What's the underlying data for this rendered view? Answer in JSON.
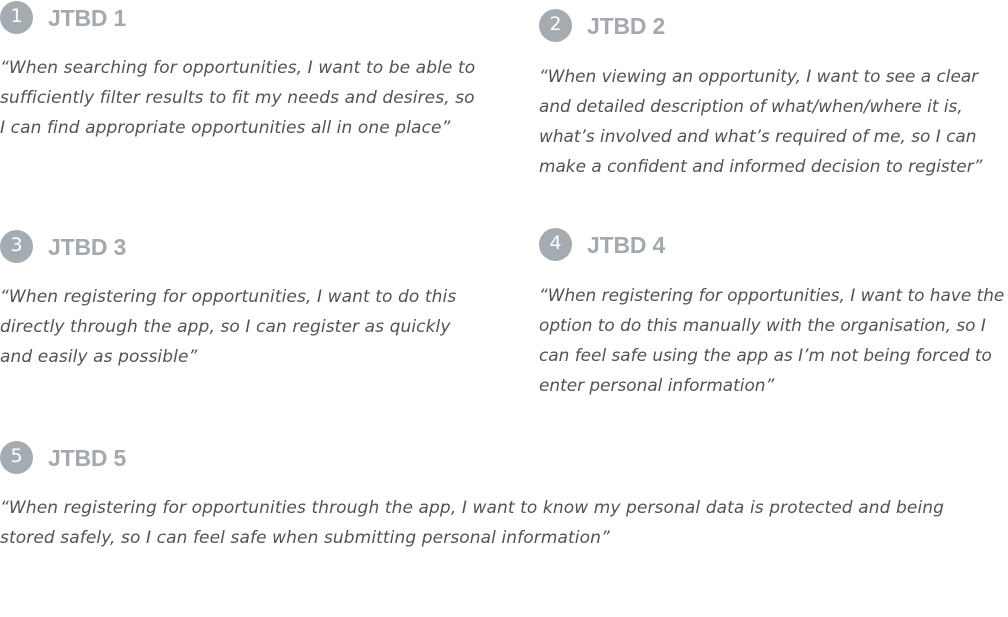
{
  "items": [
    {
      "number": "1",
      "title": "JTBD 1",
      "quote": "“When searching for opportunities, I want to be able to sufficiently filter results to fit my needs and desires, so I can find appropriate opportunities all in one place”"
    },
    {
      "number": "2",
      "title": "JTBD 2",
      "quote": "“When viewing an opportunity, I want to see a clear and detailed description of what/when/where it is, what’s involved and what’s required of me, so I can make a confident and informed decision to register”"
    },
    {
      "number": "3",
      "title": "JTBD 3",
      "quote": "“When registering for opportunities, I want to do this directly through the app, so I can register as quickly and easily as possible”"
    },
    {
      "number": "4",
      "title": "JTBD 4",
      "quote": "“When registering for opportunities, I want to have the option to do this manually with the organisation, so I can feel safe using the app as I’m not being forced to enter personal information”"
    },
    {
      "number": "5",
      "title": "JTBD 5",
      "quote": "“When registering for opportunities through the app, I want to know my personal data is protected and being stored safely, so I can feel safe when submitting personal information”"
    }
  ],
  "colors": {
    "badge": "#a4abb1",
    "title": "#a3a9af",
    "quote": "#505357"
  }
}
